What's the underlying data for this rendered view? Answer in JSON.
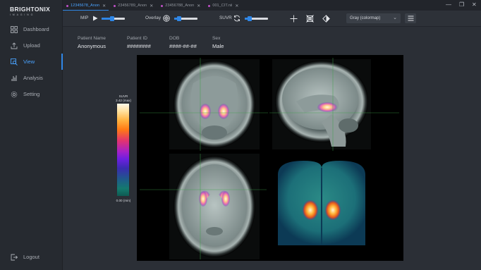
{
  "app": {
    "brand": "BRIGHTONIX",
    "brand_sub": "IMAGING"
  },
  "sidebar": {
    "items": [
      {
        "label": "Dashboard",
        "icon": "dashboard-icon"
      },
      {
        "label": "Upload",
        "icon": "upload-icon"
      },
      {
        "label": "View",
        "icon": "view-icon",
        "active": true
      },
      {
        "label": "Analysis",
        "icon": "analysis-icon"
      },
      {
        "label": "Setting",
        "icon": "gear-icon"
      }
    ],
    "logout": "Logout"
  },
  "tabs": [
    {
      "label": "12345678_Anon",
      "active": true
    },
    {
      "label": "23456789_Anon"
    },
    {
      "label": "23456788_Anon"
    },
    {
      "label": "001_CIT.nii"
    }
  ],
  "toolbar": {
    "mip_label": "MIP",
    "overlay_label": "Overlay",
    "suvr_label": "SUVR",
    "colormap": "Gray (colormap)",
    "mip_slider": 0.45,
    "overlay_slider": 0.2,
    "suvr_slider": 0.2
  },
  "patient": {
    "name_label": "Patient Name",
    "name_value": "Anonymous",
    "id_label": "Patient ID",
    "id_value": "########",
    "dob_label": "DOB",
    "dob_value": "####-##-##",
    "sex_label": "Sex",
    "sex_value": "Male"
  },
  "colorbar": {
    "title": "SUVR",
    "max": "3.42 (max)",
    "min": "0.00 (min)"
  },
  "colors": {
    "accent": "#2f86e6",
    "tab_dot": "#c051c8",
    "background": "#2b2f36"
  }
}
